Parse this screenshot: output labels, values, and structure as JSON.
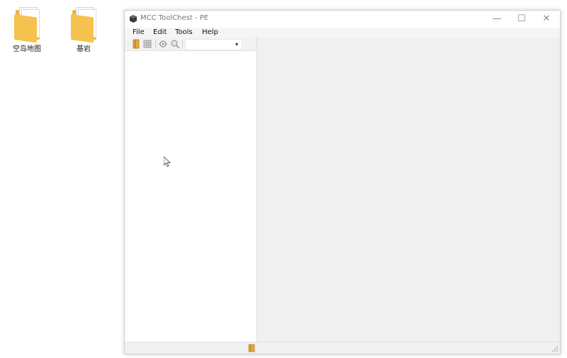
{
  "desktop": {
    "icons": [
      {
        "label": "空岛地图",
        "icon": "folder-icon"
      },
      {
        "label": "基岩",
        "icon": "folder-icon"
      }
    ]
  },
  "window": {
    "title": "MCC ToolChest - PE",
    "controls": {
      "minimize": "—",
      "maximize": "☐",
      "close": "✕"
    }
  },
  "menubar": {
    "items": [
      "File",
      "Edit",
      "Tools",
      "Help"
    ]
  },
  "toolbar": {
    "buttons": [
      "open-book-icon",
      "save-grid-icon",
      "settings-icon",
      "search-icon"
    ],
    "combo": {
      "value": "",
      "arrow": "▾"
    }
  },
  "statusbar": {
    "icon": "book-icon"
  },
  "colors": {
    "window_bg": "#f0f0f0",
    "pane_bg": "#ffffff",
    "folder": "#f5c24d"
  }
}
